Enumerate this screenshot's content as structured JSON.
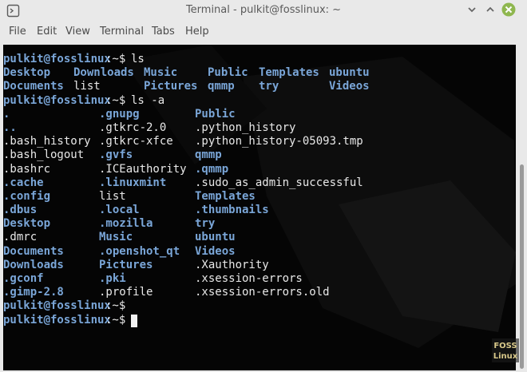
{
  "window": {
    "title": "Terminal - pulkit@fosslinux: ~",
    "accent_color": "#8fb74f"
  },
  "menubar": {
    "items": [
      "File",
      "Edit",
      "View",
      "Terminal",
      "Tabs",
      "Help"
    ]
  },
  "terminal": {
    "prompt": "pulkit@fosslinux",
    "prompt_path": ":~$",
    "cursor_color": "#f2f2f2",
    "lines": [
      {
        "type": "prompt",
        "command": "ls"
      },
      {
        "type": "cols",
        "cells": [
          {
            "t": "Desktop",
            "d": true
          },
          {
            "t": "Downloads",
            "d": true
          },
          {
            "t": "Music",
            "d": true
          },
          {
            "t": "Public",
            "d": true
          },
          {
            "t": "Templates",
            "d": true
          },
          {
            "t": "ubuntu",
            "d": true
          }
        ]
      },
      {
        "type": "cols",
        "cells": [
          {
            "t": "Documents",
            "d": true
          },
          {
            "t": "list",
            "d": false
          },
          {
            "t": "Pictures",
            "d": true
          },
          {
            "t": "qmmp",
            "d": true
          },
          {
            "t": "try",
            "d": true
          },
          {
            "t": "Videos",
            "d": true
          }
        ]
      },
      {
        "type": "prompt",
        "command": "ls -a"
      },
      {
        "type": "cols3",
        "cells": [
          {
            "t": ".",
            "d": true
          },
          {
            "t": ".gnupg",
            "d": true
          },
          {
            "t": "Public",
            "d": true
          }
        ]
      },
      {
        "type": "cols3",
        "cells": [
          {
            "t": "..",
            "d": true
          },
          {
            "t": ".gtkrc-2.0",
            "d": false
          },
          {
            "t": ".python_history",
            "d": false
          }
        ]
      },
      {
        "type": "cols3",
        "cells": [
          {
            "t": ".bash_history",
            "d": false
          },
          {
            "t": ".gtkrc-xfce",
            "d": false
          },
          {
            "t": ".python_history-05093.tmp",
            "d": false
          }
        ]
      },
      {
        "type": "cols3",
        "cells": [
          {
            "t": ".bash_logout",
            "d": false
          },
          {
            "t": ".gvfs",
            "d": true
          },
          {
            "t": "qmmp",
            "d": true
          }
        ]
      },
      {
        "type": "cols3",
        "cells": [
          {
            "t": ".bashrc",
            "d": false
          },
          {
            "t": ".ICEauthority",
            "d": false
          },
          {
            "t": ".qmmp",
            "d": true
          }
        ]
      },
      {
        "type": "cols3",
        "cells": [
          {
            "t": ".cache",
            "d": true
          },
          {
            "t": ".linuxmint",
            "d": true
          },
          {
            "t": ".sudo_as_admin_successful",
            "d": false
          }
        ]
      },
      {
        "type": "cols3",
        "cells": [
          {
            "t": ".config",
            "d": true
          },
          {
            "t": "list",
            "d": false
          },
          {
            "t": "Templates",
            "d": true
          }
        ]
      },
      {
        "type": "cols3",
        "cells": [
          {
            "t": ".dbus",
            "d": true
          },
          {
            "t": ".local",
            "d": true
          },
          {
            "t": ".thumbnails",
            "d": true
          }
        ]
      },
      {
        "type": "cols3",
        "cells": [
          {
            "t": "Desktop",
            "d": true
          },
          {
            "t": ".mozilla",
            "d": true
          },
          {
            "t": "try",
            "d": true
          }
        ]
      },
      {
        "type": "cols3",
        "cells": [
          {
            "t": ".dmrc",
            "d": false
          },
          {
            "t": "Music",
            "d": true
          },
          {
            "t": "ubuntu",
            "d": true
          }
        ]
      },
      {
        "type": "cols3",
        "cells": [
          {
            "t": "Documents",
            "d": true
          },
          {
            "t": ".openshot_qt",
            "d": true
          },
          {
            "t": "Videos",
            "d": true
          }
        ]
      },
      {
        "type": "cols3",
        "cells": [
          {
            "t": "Downloads",
            "d": true
          },
          {
            "t": "Pictures",
            "d": true
          },
          {
            "t": ".Xauthority",
            "d": false
          }
        ]
      },
      {
        "type": "cols3",
        "cells": [
          {
            "t": ".gconf",
            "d": true
          },
          {
            "t": ".pki",
            "d": true
          },
          {
            "t": ".xsession-errors",
            "d": false
          }
        ]
      },
      {
        "type": "cols3",
        "cells": [
          {
            "t": ".gimp-2.8",
            "d": true
          },
          {
            "t": ".profile",
            "d": false
          },
          {
            "t": ".xsession-errors.old",
            "d": false
          }
        ]
      },
      {
        "type": "prompt",
        "command": ""
      },
      {
        "type": "prompt",
        "command": "",
        "cursor": true
      }
    ]
  },
  "watermark": {
    "line1": "FOSS",
    "line2": "Linux"
  }
}
